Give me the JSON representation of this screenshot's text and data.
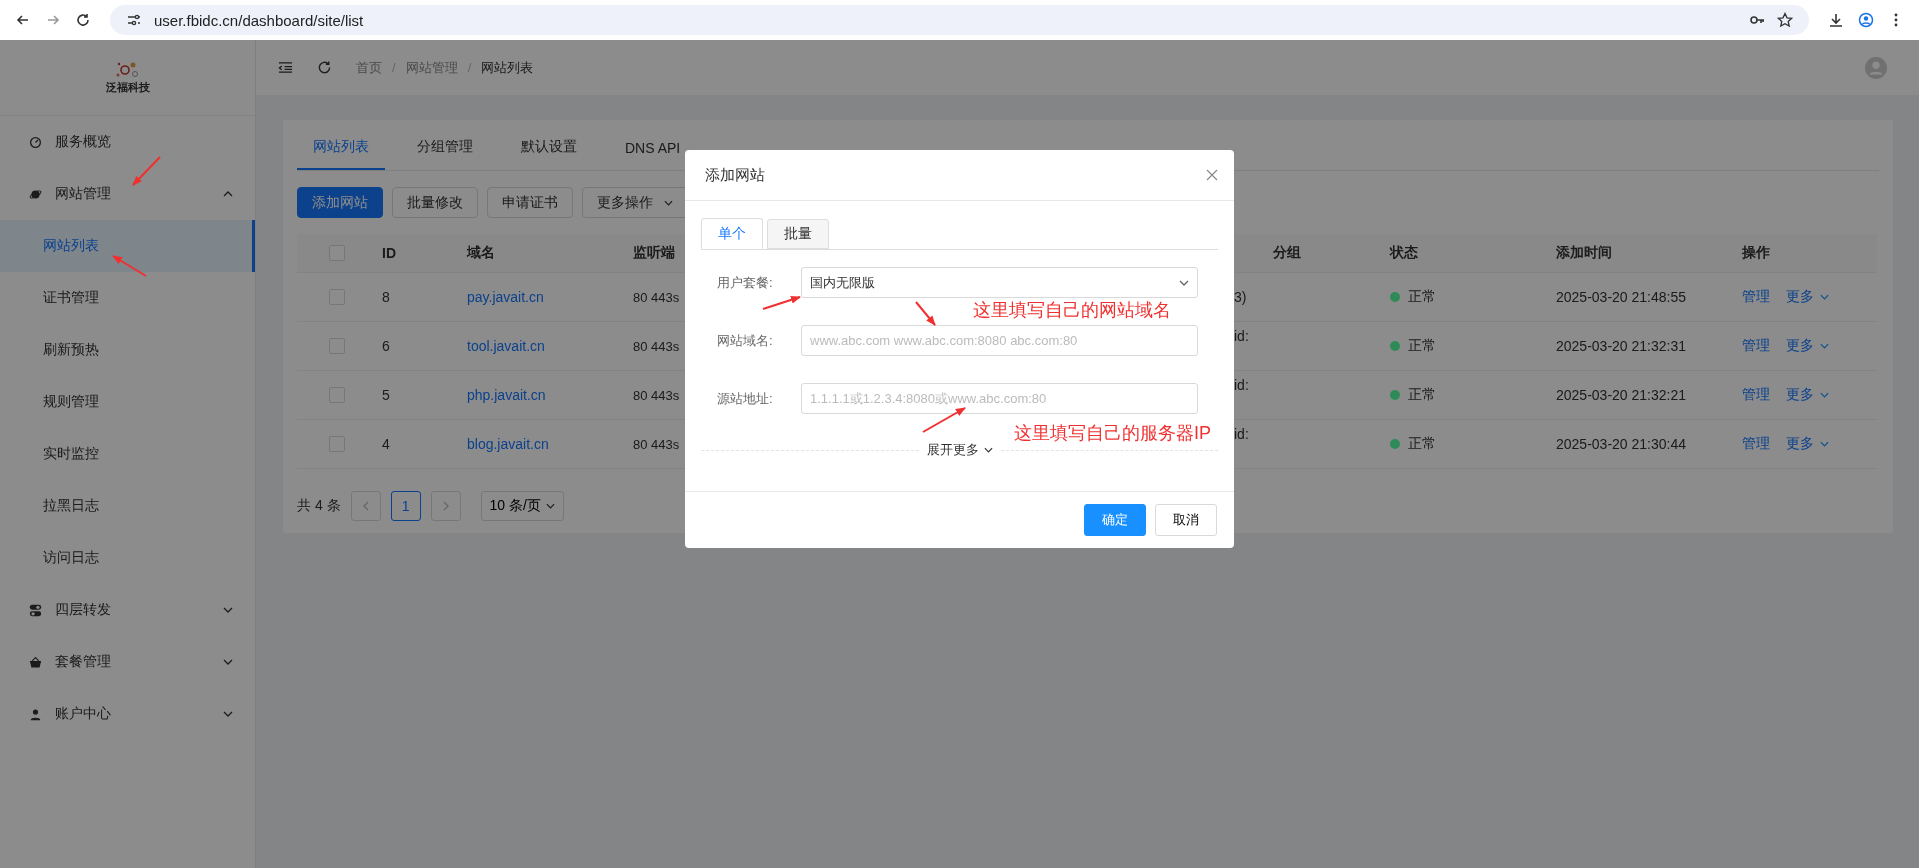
{
  "browser": {
    "url": "user.fbidc.cn/dashboard/site/list"
  },
  "sidebar": {
    "logo": "泛福科技",
    "items": [
      {
        "label": "服务概览",
        "selected": false
      },
      {
        "label": "网站管理",
        "selected": false,
        "expanded": true,
        "children": [
          {
            "label": "网站列表",
            "selected": true
          },
          {
            "label": "证书管理",
            "selected": false
          },
          {
            "label": "刷新预热",
            "selected": false
          },
          {
            "label": "规则管理",
            "selected": false
          },
          {
            "label": "实时监控",
            "selected": false
          },
          {
            "label": "拉黑日志",
            "selected": false
          },
          {
            "label": "访问日志",
            "selected": false
          }
        ]
      },
      {
        "label": "四层转发",
        "selected": false,
        "expanded": false
      },
      {
        "label": "套餐管理",
        "selected": false,
        "expanded": false
      },
      {
        "label": "账户中心",
        "selected": false,
        "expanded": false
      }
    ]
  },
  "breadcrumb": {
    "items": [
      "首页",
      "网站管理",
      "网站列表"
    ],
    "separator": "/"
  },
  "tabs": [
    {
      "label": "网站列表",
      "selected": true
    },
    {
      "label": "分组管理",
      "selected": false
    },
    {
      "label": "默认设置",
      "selected": false
    },
    {
      "label": "DNS API",
      "selected": false
    }
  ],
  "toolbar": [
    {
      "label": "添加网站",
      "kind": "primary"
    },
    {
      "label": "批量修改",
      "kind": "plain"
    },
    {
      "label": "申请证书",
      "kind": "plain"
    },
    {
      "label": "更多操作",
      "kind": "dropdown"
    }
  ],
  "table": {
    "header_checked": false,
    "columns": [
      "ID",
      "域名",
      "监听端",
      "",
      "",
      "分组",
      "状态",
      "添加时间",
      "操作"
    ],
    "rows": [
      {
        "checked": false,
        "id": "8",
        "domain": "pay.javait.cn",
        "port": "80 443s",
        "column_5": "3)",
        "status": "正常",
        "color": "#2e8b57",
        "time": "2025-03-20 21:48:55",
        "manage": "管理",
        "more": "更多"
      },
      {
        "checked": false,
        "id": "6",
        "domain": "tool.javait.cn",
        "port": "80 443s",
        "column_5": "id:",
        "status": "正常",
        "color": "#2e8b57",
        "time": "2025-03-20 21:32:31",
        "manage": "管理",
        "more": "更多"
      },
      {
        "checked": false,
        "id": "5",
        "domain": "php.javait.cn",
        "port": "80 443s",
        "column_5": "id:",
        "status": "正常",
        "color": "#2e8b57",
        "time": "2025-03-20 21:32:21",
        "manage": "管理",
        "more": "更多"
      },
      {
        "checked": false,
        "id": "4",
        "domain": "blog.javait.cn",
        "port": "80 443s",
        "column_5": "id:",
        "status": "正常",
        "color": "#2e8b57",
        "time": "2025-03-20 21:30:44",
        "manage": "管理",
        "more": "更多"
      }
    ]
  },
  "pagination": {
    "total": "共 4 条",
    "pages": [
      {
        "label": "1",
        "selected": true
      }
    ],
    "page_size": "10 条/页"
  },
  "dialog": {
    "title": "添加网站",
    "tabs": [
      {
        "label": "单个",
        "selected": true
      },
      {
        "label": "批量",
        "selected": false
      }
    ],
    "fields": [
      {
        "label": "用户套餐:",
        "kind": "select",
        "value": "国内无限版"
      },
      {
        "label": "网站域名:",
        "kind": "input",
        "placeholder": "www.abc.com www.abc.com:8080 abc.com:80"
      },
      {
        "label": "源站地址:",
        "kind": "input",
        "placeholder": "1.1.1.1或1.2.3.4:8080或www.abc.com:80"
      }
    ],
    "expand": "展开更多",
    "buttons": [
      {
        "label": "确定",
        "kind": "primary"
      },
      {
        "label": "取消",
        "kind": "plain"
      }
    ]
  },
  "annotations": [
    {
      "text": "这里填写自己的网站域名"
    },
    {
      "text": "这里填写自己的服务器IP"
    }
  ]
}
